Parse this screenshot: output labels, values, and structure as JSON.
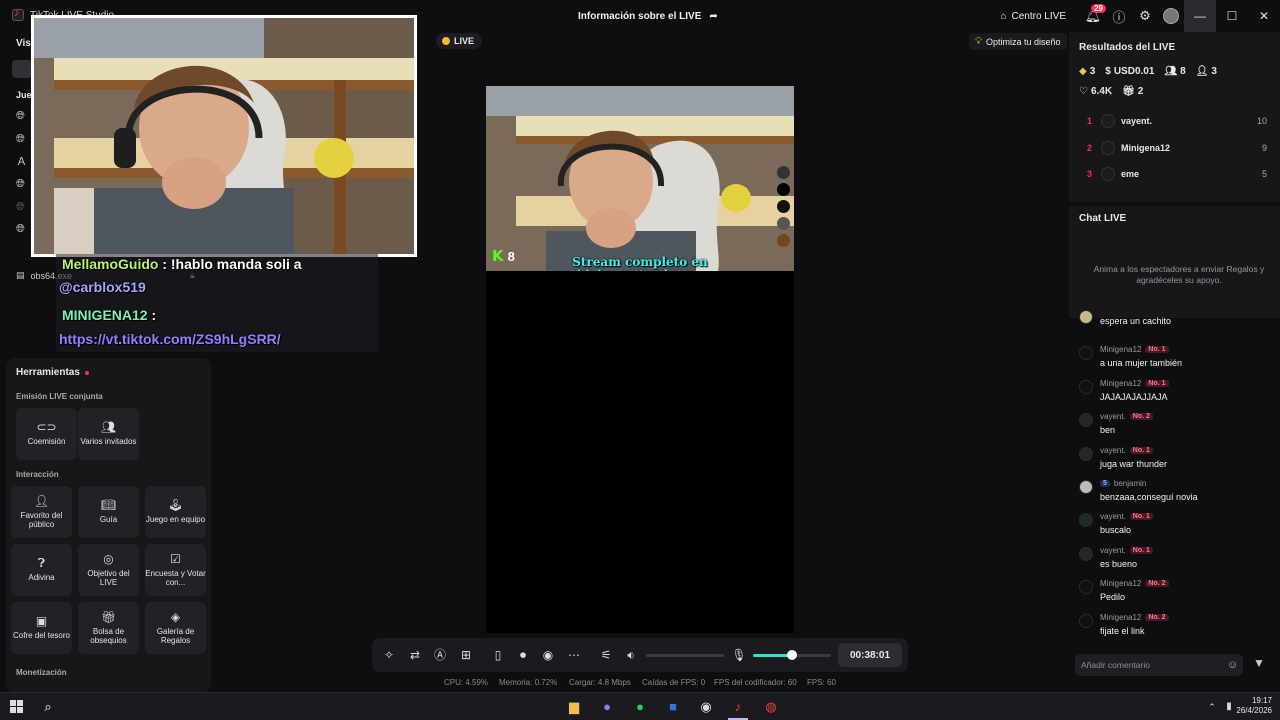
{
  "titlebar": {
    "app_title": "TikTok LIVE Studio",
    "live_info": "Información sobre el LIVE",
    "centro_live": "Centro LIVE",
    "notif_count": "29"
  },
  "left": {
    "vis_label": "Vis",
    "jue_label": "Jue",
    "obs_label": "obs64.exe",
    "tools_title": "Herramientas",
    "sections": {
      "emision": "Emisión LIVE conjunta",
      "interaccion": "Interacción",
      "monetizacion": "Monetización"
    },
    "tools": {
      "coemision": "Coemisión",
      "varios": "Varios invitados",
      "favorito": "Favorito del público",
      "guia": "Guía",
      "juego": "Juego en equipo",
      "adivina": "Adivina",
      "objetivo": "Objetivo del LIVE",
      "encuesta": "Encuesta y Votar con...",
      "cofre": "Cofre del tesoro",
      "bolsa": "Bolsa de obsequios",
      "galeria": "Galería de Regalos"
    }
  },
  "overlay": {
    "line1_user": "MellamoGuido",
    "line1_text": " : !hablo manda soli a",
    "line2": "@carblox519",
    "line3_user": "MINIGENA12",
    "line3_text": " :",
    "line4": "https://vt.tiktok.com/ZS9hLgSRR/"
  },
  "center": {
    "live_chip": "LIVE",
    "optimize": "Optimiza tu diseño",
    "kick_count": "8",
    "stream_text": "Stream completo en kick.com/soybenza",
    "timer": "00:38:01",
    "volume_level": 0.5,
    "stats": {
      "cpu": "CPU: 4.59%",
      "memoria": "Memoria: 0.72%",
      "cargar": "Cargar: 4.8 Mbps",
      "caidas": "Caídas de FPS: 0",
      "fps_cod": "FPS del codificador: 60",
      "fps": "FPS: 60"
    }
  },
  "results": {
    "title": "Resultados del LIVE",
    "diamonds": "3",
    "usd": "USD0.01",
    "viewers": "8",
    "followers": "3",
    "likes": "6.4K",
    "gifts": "2",
    "ranking": [
      {
        "rank": "1",
        "name": "vayent.",
        "score": "10"
      },
      {
        "rank": "2",
        "name": "Minigena12",
        "score": "9"
      },
      {
        "rank": "3",
        "name": "eme",
        "score": "5"
      }
    ]
  },
  "chat": {
    "title": "Chat LIVE",
    "hint": "Anima a los espectadores a enviar Regalos y agradéceles su apoyo.",
    "messages": [
      {
        "user": "",
        "badge": "",
        "text": "espera un cachito"
      },
      {
        "user": "Minigena12",
        "badge": "No. 1",
        "text": "a una mujer también"
      },
      {
        "user": "Minigena12",
        "badge": "No. 1",
        "text": "JAJAJAJAJJAJA"
      },
      {
        "user": "vayent.",
        "badge": "No. 2",
        "text": "ben"
      },
      {
        "user": "vayent.",
        "badge": "No. 1",
        "text": "juga war thunder"
      },
      {
        "user": "benjamin",
        "badge": "5",
        "text": "benzaaa,conseguí novia"
      },
      {
        "user": "vayent.",
        "badge": "No. 1",
        "text": "buscalo"
      },
      {
        "user": "vayent.",
        "badge": "No. 1",
        "text": "es bueno"
      },
      {
        "user": "Minigena12",
        "badge": "No. 2",
        "text": "Pedilo"
      },
      {
        "user": "Minigena12",
        "badge": "No. 2",
        "text": "fijate el link"
      }
    ],
    "comment_placeholder": "Añadir comentario"
  },
  "taskbar": {
    "time": "19:17",
    "date": "26/4/2026"
  }
}
